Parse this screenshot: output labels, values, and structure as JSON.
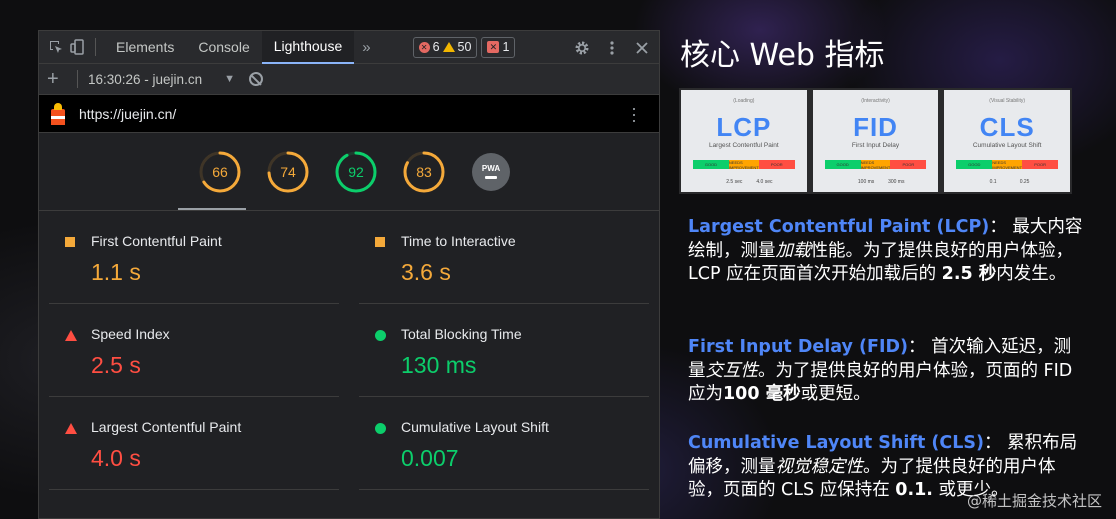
{
  "devtools": {
    "tabs": [
      "Elements",
      "Console",
      "Lighthouse"
    ],
    "more_tabs": "»",
    "errors": "6",
    "warnings": "50",
    "issues": "1",
    "report_time": "16:30:26 - juejin.cn",
    "url": "https://juejin.cn/",
    "scores": [
      {
        "value": 66,
        "color": "#f4a93a"
      },
      {
        "value": 74,
        "color": "#f4a93a"
      },
      {
        "value": 92,
        "color": "#0cce6b"
      },
      {
        "value": 83,
        "color": "#f4a93a"
      }
    ],
    "pwa_label": "PWA",
    "metrics": [
      {
        "label": "First Contentful Paint",
        "value": "1.1 s",
        "status": "average"
      },
      {
        "label": "Time to Interactive",
        "value": "3.6 s",
        "status": "average"
      },
      {
        "label": "Speed Index",
        "value": "2.5 s",
        "status": "fail"
      },
      {
        "label": "Total Blocking Time",
        "value": "130 ms",
        "status": "pass"
      },
      {
        "label": "Largest Contentful Paint",
        "value": "4.0 s",
        "status": "fail"
      },
      {
        "label": "Cumulative Layout Shift",
        "value": "0.007",
        "status": "pass"
      }
    ]
  },
  "slide": {
    "title": "核心 Web 指标",
    "cards": [
      {
        "top": "(Loading)",
        "abbr": "LCP",
        "name": "Largest Contentful Paint",
        "good": "GOOD",
        "mid": "NEEDS IMPROVEMENT",
        "poor": "POOR",
        "t1": "2.5 sec",
        "t2": "4.0 sec"
      },
      {
        "top": "(Interactivity)",
        "abbr": "FID",
        "name": "First Input Delay",
        "good": "GOOD",
        "mid": "NEEDS IMPROVEMENT",
        "poor": "POOR",
        "t1": "100 ms",
        "t2": "300 ms"
      },
      {
        "top": "(Visual Stability)",
        "abbr": "CLS",
        "name": "Cumulative Layout Shift",
        "good": "GOOD",
        "mid": "NEEDS IMPROVEMENT",
        "poor": "POOR",
        "t1": "0.1",
        "t2": "0.25"
      }
    ],
    "lcp": {
      "term": "Largest Contentful Paint (LCP)",
      "p1": "： 最大内容绘制，测量",
      "em": "加载",
      "p2": "性能。为了提供良好的用户体验，LCP 应在页面首次开始加载后的 ",
      "strong": "2.5 秒",
      "p3": "内发生。"
    },
    "fid": {
      "term": "First Input Delay (FID)",
      "p1": "： 首次输入延迟，测量",
      "em": "交互性",
      "p2": "。为了提供良好的用户体验，页面的 FID 应为",
      "strong": "100 毫秒",
      "p3": "或更短。"
    },
    "cls": {
      "term": "Cumulative Layout Shift (CLS)",
      "p1": "： 累积布局偏移，测量",
      "em": "视觉稳定性",
      "p2": "。为了提供良好的用户体验，页面的 CLS 应保持在 ",
      "strong": "0.1.",
      "p3": " 或更少。"
    },
    "watermark": "@稀土掘金技术社区"
  },
  "colors": {
    "average": "#f4a93a",
    "fail": "#ff4e42",
    "pass": "#0cce6b",
    "accent": "#4f86f7"
  }
}
